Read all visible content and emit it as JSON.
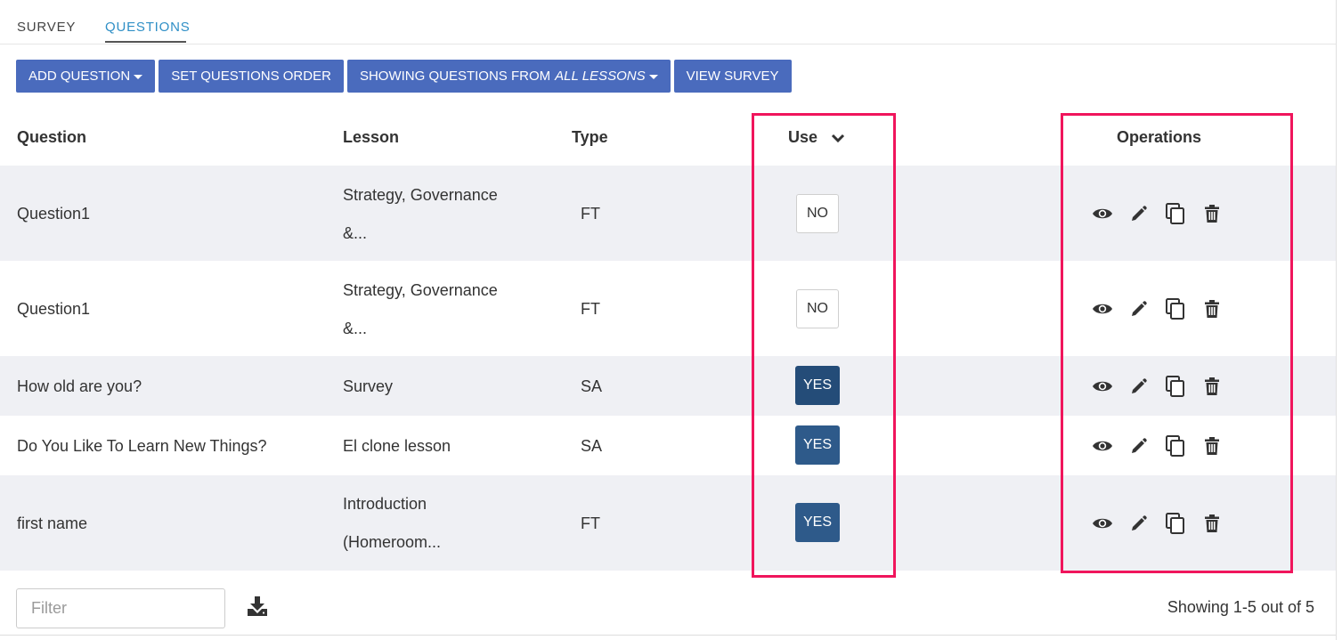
{
  "tabs": [
    {
      "label": "SURVEY"
    },
    {
      "label": "QUESTIONS",
      "active": true
    }
  ],
  "toolbar": {
    "add_question": "ADD QUESTION",
    "set_order": "SET QUESTIONS ORDER",
    "showing_prefix": "SHOWING QUESTIONS FROM",
    "showing_scope": "ALL LESSONS",
    "view_survey": "VIEW SURVEY"
  },
  "table": {
    "headers": {
      "question": "Question",
      "lesson": "Lesson",
      "type": "Type",
      "use": "Use",
      "operations": "Operations"
    },
    "rows": [
      {
        "question": "Question1",
        "lesson_line1": "Strategy, Governance",
        "lesson_line2": "&...",
        "type": "FT",
        "use": "NO"
      },
      {
        "question": "Question1",
        "lesson_line1": "Strategy, Governance",
        "lesson_line2": "&...",
        "type": "FT",
        "use": "NO"
      },
      {
        "question": "How old are you?",
        "lesson_line1": "Survey",
        "lesson_line2": "",
        "type": "SA",
        "use": "YES"
      },
      {
        "question": "Do You Like To Learn New Things?",
        "lesson_line1": "El clone lesson",
        "lesson_line2": "",
        "type": "SA",
        "use": "YES"
      },
      {
        "question": "first name",
        "lesson_line1": "Introduction",
        "lesson_line2": "(Homeroom...",
        "type": "FT",
        "use": "YES"
      }
    ]
  },
  "operation_icons": [
    "eye-icon",
    "pencil-icon",
    "copy-icon",
    "trash-icon"
  ],
  "footer": {
    "filter_placeholder": "Filter",
    "paging": "Showing 1-5 out of 5"
  },
  "colors": {
    "button": "#4a6bbd",
    "active_tab": "#2f8fc6",
    "yes_toggle": "#2e5a8a",
    "highlight": "#f0155c",
    "row_shade": "#eff0f4"
  }
}
